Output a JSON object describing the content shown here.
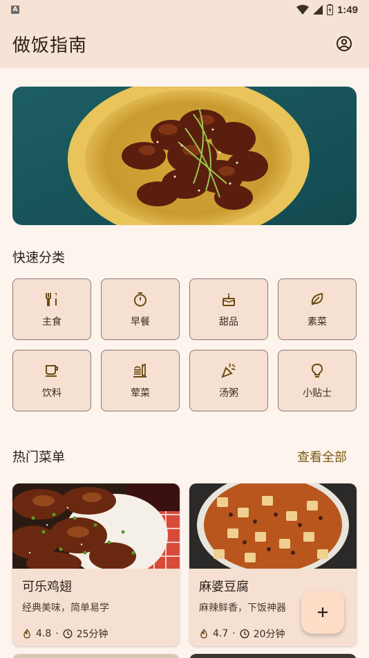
{
  "status_bar": {
    "app_icon_letter": "A",
    "time": "1:49",
    "icons": [
      "wifi-icon",
      "signal-icon",
      "battery-icon"
    ]
  },
  "app_bar": {
    "title": "做饭指南",
    "account_icon": "account-circle-icon"
  },
  "hero": {
    "image": "braised ribs on yellow plate"
  },
  "quick_categories": {
    "title": "快速分类",
    "items": [
      {
        "label": "主食",
        "icon": "utensils-icon"
      },
      {
        "label": "早餐",
        "icon": "timer-icon"
      },
      {
        "label": "甜品",
        "icon": "cake-icon"
      },
      {
        "label": "素菜",
        "icon": "leaf-icon"
      },
      {
        "label": "饮料",
        "icon": "cup-icon"
      },
      {
        "label": "荤菜",
        "icon": "food-bank-icon"
      },
      {
        "label": "汤粥",
        "icon": "celebration-icon"
      },
      {
        "label": "小贴士",
        "icon": "lightbulb-icon"
      }
    ]
  },
  "popular": {
    "title": "热门菜单",
    "see_all": "查看全部",
    "recipes": [
      {
        "name": "可乐鸡翅",
        "desc": "经典美味，简单易学",
        "rating": "4.8",
        "separator": "·",
        "time": "25分钟"
      },
      {
        "name": "麻婆豆腐",
        "desc": "麻辣鲜香，下饭神器",
        "rating": "4.7",
        "separator": "·",
        "time": "20分钟"
      }
    ]
  },
  "fab": {
    "icon": "plus-icon",
    "symbol": "+"
  },
  "colors": {
    "background": "#fdf4ee",
    "top_bar": "#f6e3d5",
    "card": "#f5e0d2",
    "accent_text": "#7c5a10",
    "icon_brown": "#6b4a10",
    "fab": "#ffdcc6"
  }
}
